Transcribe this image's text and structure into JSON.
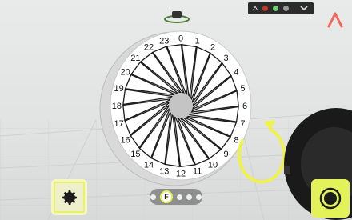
{
  "pager": {
    "active_label": "F",
    "dot_count": 5,
    "active_index": 1
  },
  "dial": {
    "numbers": [
      "0",
      "1",
      "2",
      "3",
      "4",
      "5",
      "6",
      "7",
      "8",
      "9",
      "10",
      "11",
      "12",
      "13",
      "14",
      "15",
      "16",
      "17",
      "18",
      "19",
      "20",
      "21",
      "22",
      "23"
    ]
  },
  "icons": {
    "settings": "gear-icon",
    "record": "record-icon",
    "rotate": "rotate-gesture-icon",
    "ar_anchor": "ar-anchor-icon",
    "tree": "tree-icon",
    "chevron": "chevron-down-icon",
    "logo": "app-logo"
  },
  "status": {
    "dot_colors": [
      "#c0392b",
      "#6fd36f",
      "#9a9a9a"
    ]
  },
  "colors": {
    "accent": "#e4f25a",
    "gesture": "#eef24a",
    "logo": "#f0685a"
  }
}
